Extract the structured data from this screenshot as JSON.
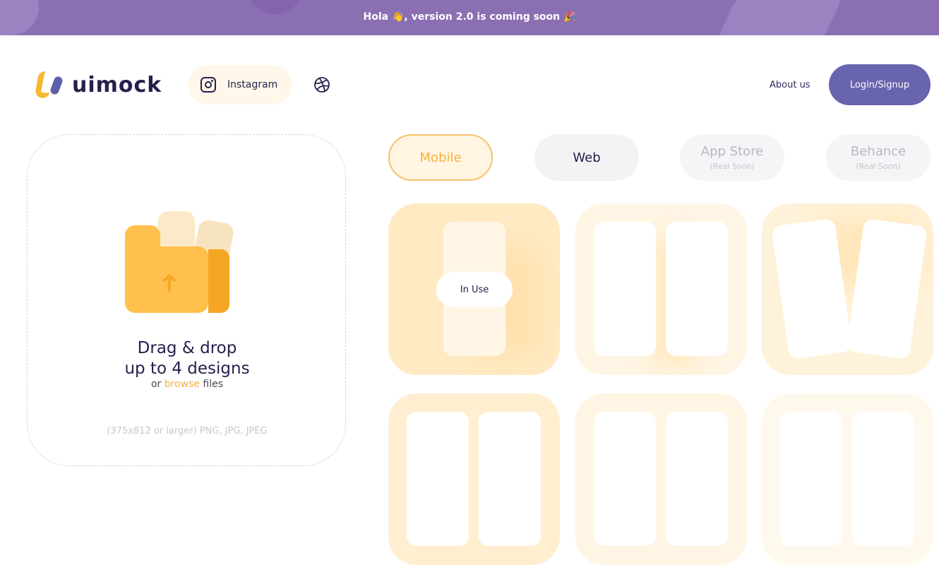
{
  "banner": {
    "text": "Hola 👋, version 2.0 is coming soon 🎉"
  },
  "header": {
    "logo_text": "uimock",
    "instagram_label": "Instagram",
    "about_label": "About us",
    "login_label": "Login/Signup"
  },
  "upload": {
    "title_line1": "Drag & drop",
    "title_line2": "up to 4 designs",
    "or_text": "or ",
    "browse_text": "browse",
    "files_text": " files",
    "formats": "(375x812 or larger) PNG, JPG, JPEG"
  },
  "tabs": [
    {
      "label": "Mobile",
      "sub": "",
      "state": "active"
    },
    {
      "label": "Web",
      "sub": "",
      "state": "normal"
    },
    {
      "label": "App Store",
      "sub": "(Real Soon)",
      "state": "disabled"
    },
    {
      "label": "Behance",
      "sub": "(Real Soon)",
      "state": "disabled"
    }
  ],
  "mockups": {
    "in_use_label": "In Use"
  },
  "colors": {
    "banner": "#8b6fb3",
    "accent": "#f7b13d",
    "primary": "#6864ad",
    "text_dark": "#24214d"
  },
  "icons": [
    "logo-icon",
    "instagram-icon",
    "dribbble-icon",
    "upload-folder-icon",
    "upload-arrow-icon"
  ]
}
